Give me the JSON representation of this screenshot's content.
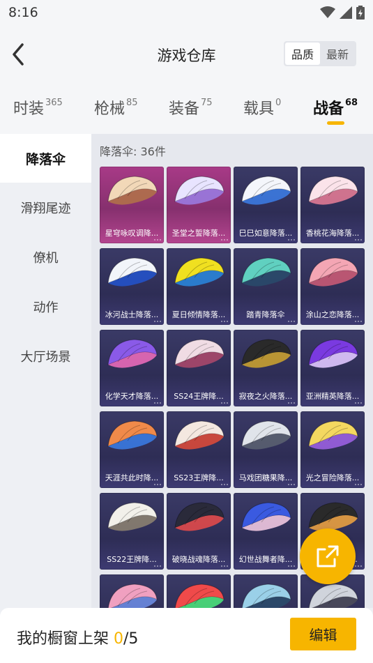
{
  "status_bar": {
    "time": "8:16"
  },
  "header": {
    "title": "游戏仓库",
    "sort_options": [
      "品质",
      "最新"
    ]
  },
  "tabs": [
    {
      "label": "时装",
      "count": "365"
    },
    {
      "label": "枪械",
      "count": "85"
    },
    {
      "label": "装备",
      "count": "75"
    },
    {
      "label": "载具",
      "count": "0"
    },
    {
      "label": "战备",
      "count": "68"
    }
  ],
  "sidebar": {
    "items": [
      "降落伞",
      "滑翔尾迹",
      "僚机",
      "动作",
      "大厅场景"
    ]
  },
  "section_title": "降落伞: 36件",
  "items": [
    {
      "label": "星穹咏叹调降...",
      "quality": "legendary",
      "colors": [
        "#f2d8b8",
        "#b0704a"
      ]
    },
    {
      "label": "圣堂之誓降落...",
      "quality": "legendary",
      "colors": [
        "#e8e4ff",
        "#9a7ae0"
      ]
    },
    {
      "label": "巳巳如意降落...",
      "quality": "epic",
      "colors": [
        "#f4f6fb",
        "#3c7ae0"
      ]
    },
    {
      "label": "香桃花海降落...",
      "quality": "epic",
      "colors": [
        "#fbe3ea",
        "#e07a94"
      ]
    },
    {
      "label": "冰河战士降落...",
      "quality": "epic",
      "colors": [
        "#f2f5fa",
        "#2452c8"
      ]
    },
    {
      "label": "夏日倾情降落...",
      "quality": "epic",
      "colors": [
        "#f0e020",
        "#2a84d8"
      ]
    },
    {
      "label": "踏青降落伞",
      "quality": "epic",
      "colors": [
        "#60d0c0",
        "#2a4a6a"
      ]
    },
    {
      "label": "涂山之恋降落...",
      "quality": "epic",
      "colors": [
        "#f4a6b4",
        "#c85a74"
      ]
    },
    {
      "label": "化学天才降落...",
      "quality": "epic",
      "colors": [
        "#8a5ae8",
        "#e86ab8"
      ]
    },
    {
      "label": "SS24王牌降...",
      "quality": "epic",
      "colors": [
        "#f0dce4",
        "#a8486a"
      ]
    },
    {
      "label": "寂夜之火降落...",
      "quality": "epic",
      "colors": [
        "#2a2a2a",
        "#c8a030"
      ]
    },
    {
      "label": "亚洲精英降落...",
      "quality": "epic",
      "colors": [
        "#7a3ae0",
        "#e0c8ff"
      ]
    },
    {
      "label": "天涯共此时降...",
      "quality": "epic",
      "colors": [
        "#f08a4a",
        "#3a7ae0"
      ]
    },
    {
      "label": "SS23王牌降...",
      "quality": "epic",
      "colors": [
        "#f4e8e0",
        "#d84a3a"
      ]
    },
    {
      "label": "马戏团糖果降...",
      "quality": "epic",
      "colors": [
        "#e0e4ea",
        "#5a6070"
      ]
    },
    {
      "label": "光之冒险降落...",
      "quality": "epic",
      "colors": [
        "#f4d860",
        "#9a60e0"
      ]
    },
    {
      "label": "SS22王牌降...",
      "quality": "epic",
      "colors": [
        "#f2f0ea",
        "#8a8070"
      ]
    },
    {
      "label": "破晓战魂降落...",
      "quality": "epic",
      "colors": [
        "#2a2a3a",
        "#e04a4a"
      ]
    },
    {
      "label": "幻世战舞者降...",
      "quality": "epic",
      "colors": [
        "#3a5ae0",
        "#f0c8e0"
      ]
    },
    {
      "label": "SS21王牌降...",
      "quality": "epic",
      "colors": [
        "#2a2a2a",
        "#e8a040"
      ]
    },
    {
      "label": "",
      "quality": "epic",
      "colors": [
        "#f0a0c0",
        "#6a8ae0"
      ]
    },
    {
      "label": "",
      "quality": "epic",
      "colors": [
        "#f04a4a",
        "#4ae07a"
      ]
    },
    {
      "label": "",
      "quality": "epic",
      "colors": [
        "#9ad0e8",
        "#2a4a6a"
      ]
    },
    {
      "label": "",
      "quality": "epic",
      "colors": [
        "#d0d4dc",
        "#4a4a5a"
      ]
    }
  ],
  "bottom_bar": {
    "caption_prefix": "我的橱窗上架 ",
    "shown": "0",
    "caption_suffix": "/5",
    "edit_label": "编辑"
  },
  "icons": {
    "back": "chevron-left-icon",
    "wifi": "wifi-icon",
    "signal": "signal-icon",
    "battery": "battery-charging-icon",
    "share": "share-external-icon"
  },
  "colors": {
    "accent": "#f7b500",
    "legendary_card": "#a83a87",
    "epic_card": "#3a3a66"
  }
}
